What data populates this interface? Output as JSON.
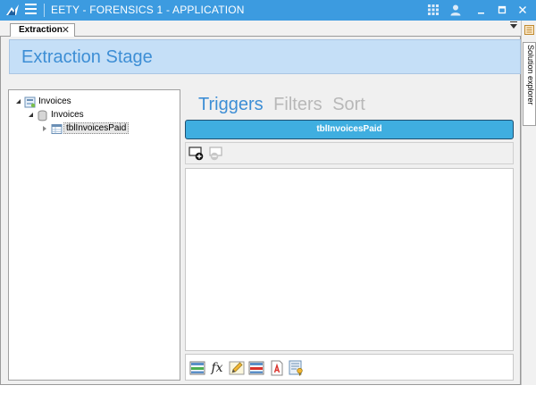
{
  "app": {
    "title": "EETY - FORENSICS 1 - APPLICATION",
    "titlebar_color": "#3c9be0"
  },
  "titlebar_icons": [
    "app-logo-icon",
    "menu-icon",
    "grid-icon",
    "user-icon",
    "minimize-icon",
    "maximize-icon",
    "close-icon"
  ],
  "document_tabs": [
    {
      "label": "Extraction",
      "close": "✕",
      "active": true
    }
  ],
  "side_panel": {
    "label": "Solution explorer"
  },
  "stage": {
    "title": "Extraction Stage",
    "title_color": "#3d8ed5"
  },
  "tree": {
    "items": [
      {
        "label": "Invoices",
        "level": 0,
        "expanded": true,
        "icon": "database-icon"
      },
      {
        "label": "Invoices",
        "level": 1,
        "expanded": true,
        "icon": "schema-icon"
      },
      {
        "label": "tblInvoicesPaid",
        "level": 2,
        "expanded": false,
        "icon": "table-icon",
        "selected": true
      }
    ]
  },
  "sections": {
    "tabs": [
      {
        "label": "Triggers",
        "active": true
      },
      {
        "label": "Filters",
        "active": false
      },
      {
        "label": "Sort",
        "active": false
      }
    ]
  },
  "selected_table": {
    "label": "tblInvoicesPaid",
    "color": "#3faee0"
  },
  "mini_toolbar": [
    "add-trigger-icon",
    "remove-trigger-icon"
  ],
  "bottom_toolbar": {
    "buttons": [
      {
        "icon": "add-row-icon"
      },
      {
        "icon": "function-icon",
        "label": "fx"
      },
      {
        "icon": "edit-pencil-icon"
      },
      {
        "icon": "remove-row-icon"
      },
      {
        "icon": "text-document-icon"
      },
      {
        "icon": "properties-key-icon"
      }
    ]
  }
}
